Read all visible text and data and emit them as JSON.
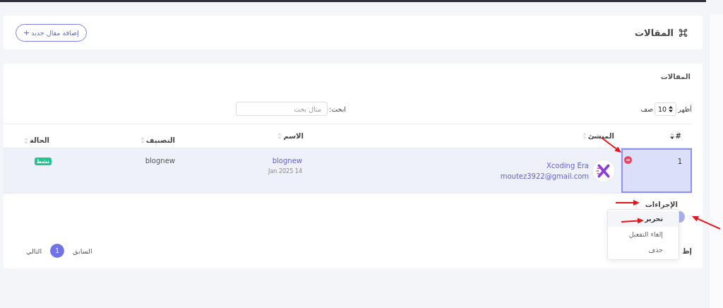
{
  "page_title": "المقالات",
  "add_button": {
    "icon": "+",
    "label": "إضافة مقال جديد"
  },
  "section_title": "المقالات",
  "length_control": {
    "before": "أظهر",
    "value": "10",
    "after": "صف"
  },
  "search": {
    "label": "ابحث:",
    "placeholder": "مثال بحث"
  },
  "table": {
    "columns": [
      {
        "label": "#",
        "sorted": true
      },
      {
        "label": "المنشئ",
        "sorted": false
      },
      {
        "label": "الاسم",
        "sorted": false
      },
      {
        "label": "التصنيف",
        "sorted": false
      },
      {
        "label": "الحالة",
        "sorted": false
      }
    ],
    "rows": [
      {
        "number": "1",
        "selected": true,
        "expanded": true,
        "creator_name": "Xcoding Era",
        "creator_email": "moutez3922@gmail.com",
        "name": "blognew",
        "date": "Jan 2025 14",
        "category": "blognew",
        "status": "نشط"
      }
    ]
  },
  "child_row": {
    "label": "الإجراءات"
  },
  "info_text": "إظ",
  "actions_menu": {
    "items": [
      {
        "label": "تحرير",
        "selected": true
      },
      {
        "label": "إلغاء التفعيل",
        "selected": false
      },
      {
        "label": "حذف",
        "selected": false
      }
    ]
  },
  "pagination": {
    "previous": "السابق",
    "next": "التالي",
    "pages": [
      {
        "label": "1",
        "selected": true
      }
    ]
  }
}
